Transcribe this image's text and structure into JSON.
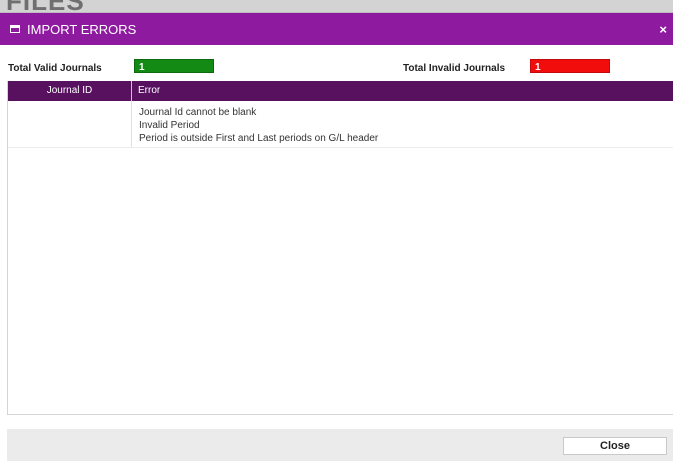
{
  "background": {
    "heading": "FILES"
  },
  "dialog": {
    "title": "IMPORT ERRORS",
    "close_icon": "×",
    "accent_color": "#8e1b9f",
    "header_color": "#57115f"
  },
  "totals": {
    "valid_label": "Total Valid Journals",
    "valid_value": "1",
    "valid_color": "#138a13",
    "invalid_label": "Total Invalid Journals",
    "invalid_value": "1",
    "invalid_color": "#f20d0d"
  },
  "grid": {
    "columns": [
      "Journal ID",
      "Error"
    ],
    "rows": [
      {
        "journal_id": "",
        "errors": [
          "Journal Id cannot be blank",
          "Invalid Period",
          "Period is outside First and Last periods on G/L header"
        ]
      }
    ]
  },
  "footer": {
    "close_label": "Close"
  }
}
